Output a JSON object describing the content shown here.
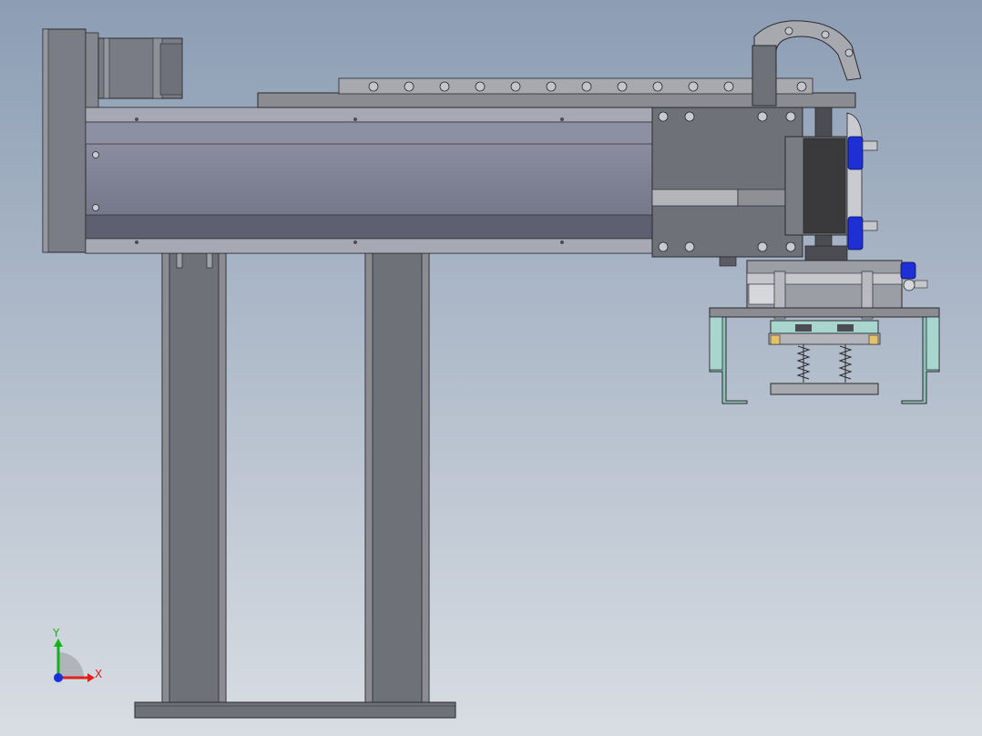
{
  "viewport": {
    "background_top": "#8c9db4",
    "background_bottom": "#d8dde3"
  },
  "colors": {
    "steel_dark": "#6f7178",
    "steel_mid": "#8a8c92",
    "steel_light": "#b9bcc2",
    "edge": "#2a2a2e",
    "blue_fitting": "#1f2fd6",
    "teal_part": "#a8d6cf",
    "black_block": "#3a3a3c"
  },
  "icons": {
    "triad": "coordinate-triad-icon"
  },
  "triad": {
    "x_label": "X",
    "y_label": "Y",
    "x_color": "#e0201c",
    "y_color": "#12b21c",
    "z_color": "#1a2fd8"
  }
}
